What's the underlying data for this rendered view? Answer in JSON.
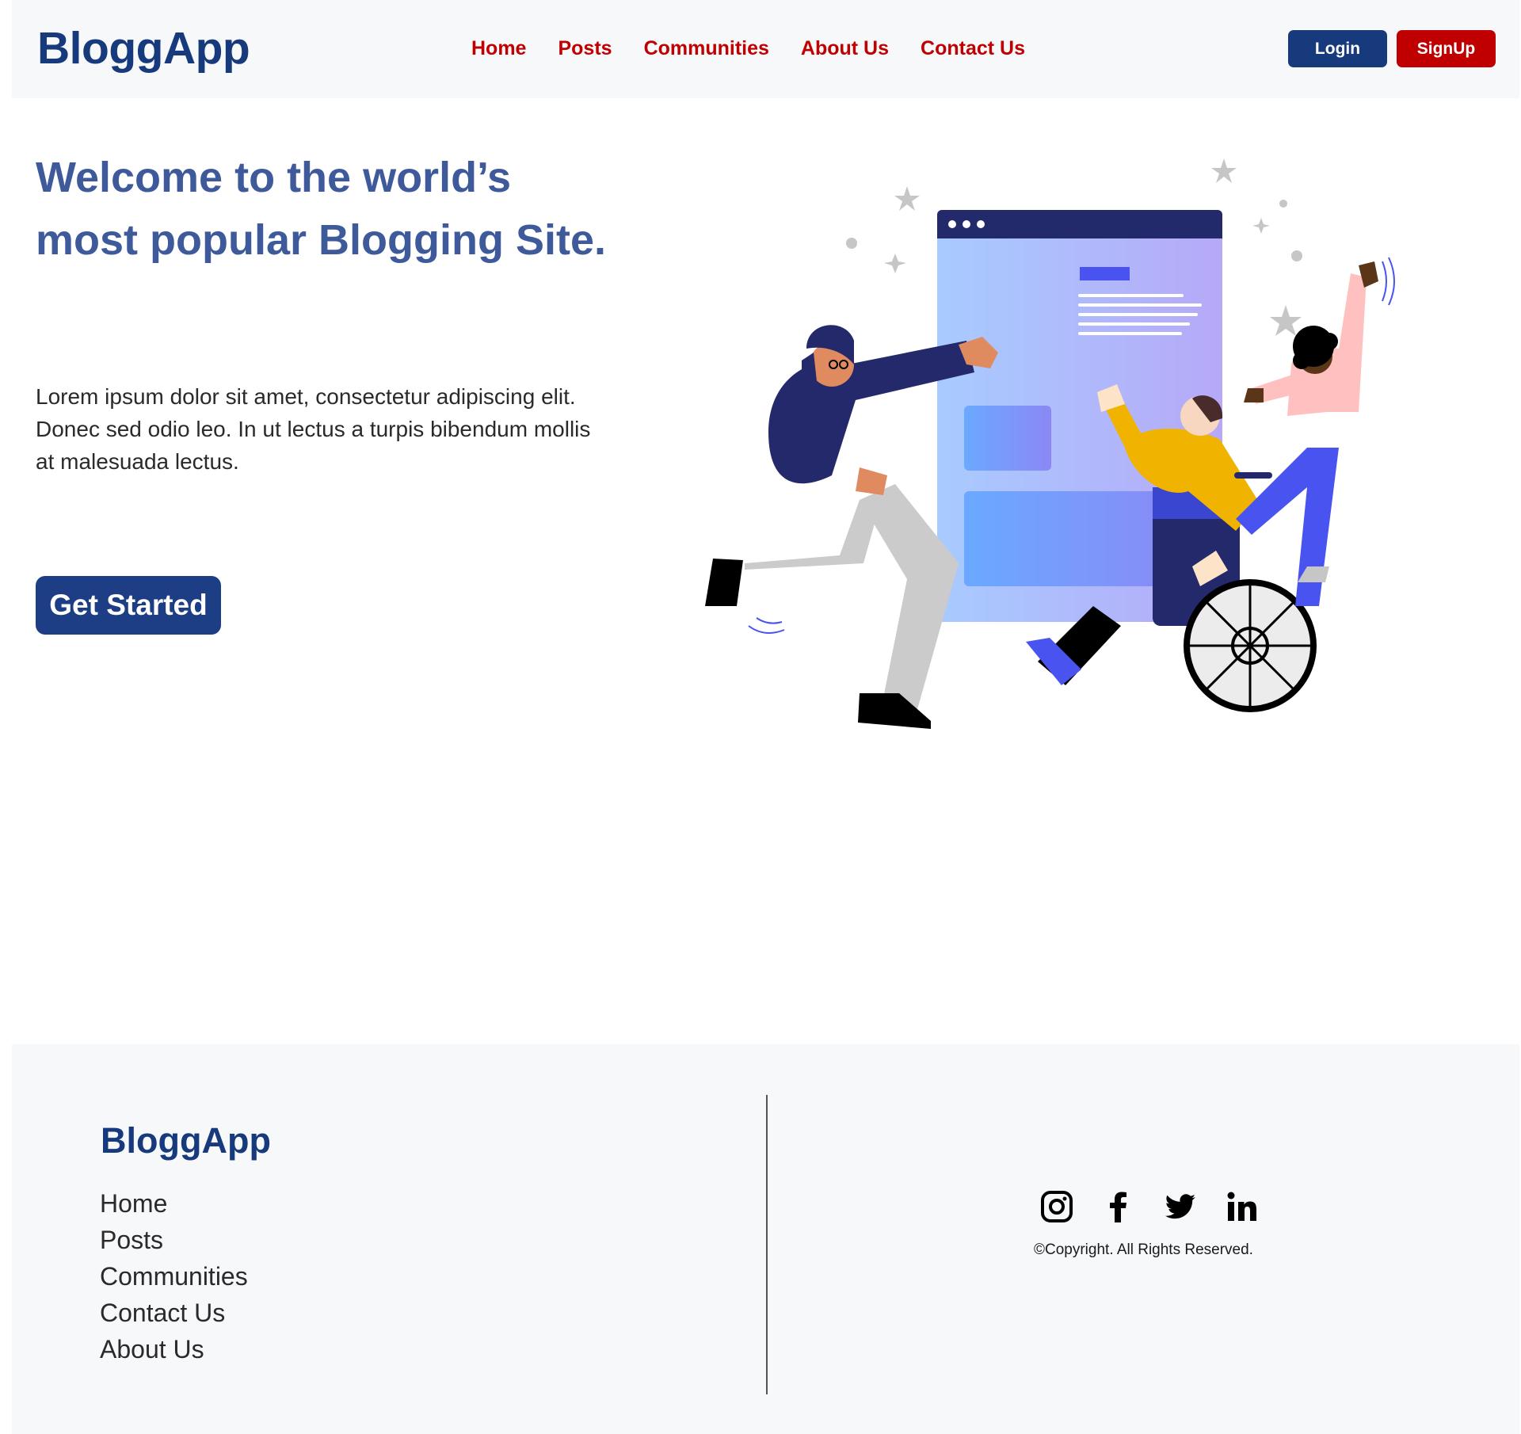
{
  "navbar": {
    "brand": "BloggApp",
    "links": [
      "Home",
      "Posts",
      "Communities",
      "About Us",
      "Contact Us"
    ],
    "login_label": "Login",
    "signup_label": "SignUp"
  },
  "hero": {
    "title": "Welcome to the world’s most popular Blogging Site.",
    "text": "Lorem ipsum dolor sit amet, consectetur adipiscing elit. Donec sed odio leo. In ut lectus a turpis bibendum mollis at malesuada lectus.",
    "cta_label": "Get Started",
    "illustration": "people-building-website-illustration"
  },
  "footer": {
    "brand": "BloggApp",
    "links": [
      "Home",
      "Posts",
      "Communities",
      "Contact Us",
      "About Us"
    ],
    "socials": [
      "instagram-icon",
      "facebook-icon",
      "twitter-icon",
      "linkedin-icon"
    ],
    "copyright": "©Copyright. All Rights Reserved."
  },
  "colors": {
    "brand_blue": "#173a7c",
    "nav_red": "#c00000",
    "hero_title": "#3e5a9a",
    "cta_blue": "#1d3d84",
    "bar_bg": "#f7f8fa"
  }
}
